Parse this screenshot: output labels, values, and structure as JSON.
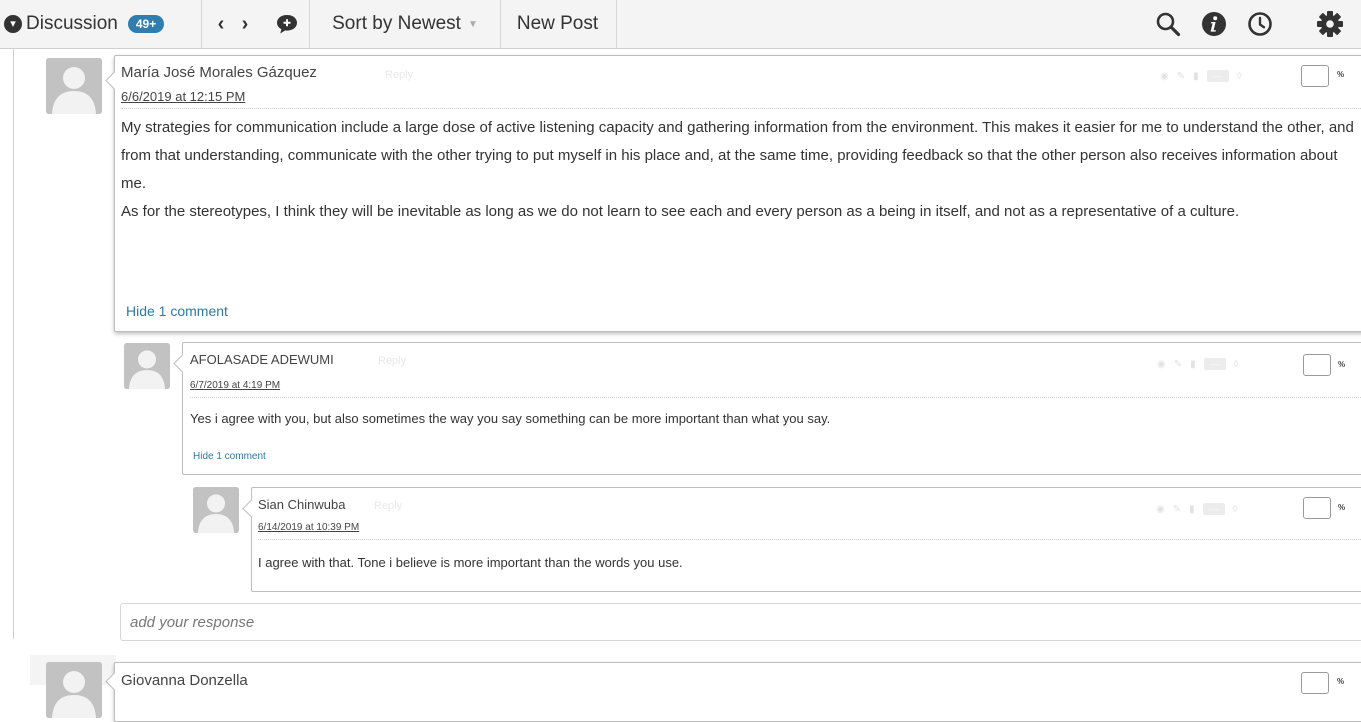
{
  "toolbar": {
    "discussion_label": "Discussion",
    "badge": "49+",
    "prev_glyph": "‹",
    "next_glyph": "›",
    "sort_label": "Sort by Newest",
    "new_post_label": "New Post",
    "icons": [
      "chevron-down-icon",
      "prev-arrow-icon",
      "next-arrow-icon",
      "chat-bubble-icon",
      "search-icon",
      "info-icon",
      "clock-icon",
      "gear-icon"
    ]
  },
  "posts": [
    {
      "author": "María José Morales Gázquez",
      "reply_tag": "Reply",
      "date": "6/6/2019 at 12:15 PM",
      "paragraphs": [
        "My strategies for communication include a large dose of active listening capacity and gathering information from the environment. This makes it easier for me to understand the other, and from that understanding, communicate with the other trying to put myself in his place and, at the same time, providing feedback so that the other person also receives information about me.",
        "As for the stereotypes, I think they will be inevitable as long as we do not learn to see each and every person as a being in itself, and not as a representative of a culture."
      ],
      "hide_link": "Hide 1 comment",
      "percent_sign": "%"
    },
    {
      "author": "AFOLASADE ADEWUMI",
      "reply_tag": "Reply",
      "date": "6/7/2019 at 4:19 PM",
      "body": "Yes  i agree with you, but also sometimes the way you say something can be more important than what you say.",
      "hide_link": "Hide 1 comment",
      "percent_sign": "%"
    },
    {
      "author": "Sian Chinwuba",
      "reply_tag": "Reply",
      "date": "6/14/2019 at 10:39 PM",
      "body": "I agree with that. Tone i believe is more important than the words you use.",
      "percent_sign": "%"
    },
    {
      "author": "Giovanna Donzella",
      "percent_sign": "%"
    }
  ],
  "response": {
    "placeholder": "add your response"
  },
  "colors": {
    "accent": "#2e7fb0",
    "link": "#2b7aa8",
    "toolbar_bg": "#f4f4f4"
  }
}
